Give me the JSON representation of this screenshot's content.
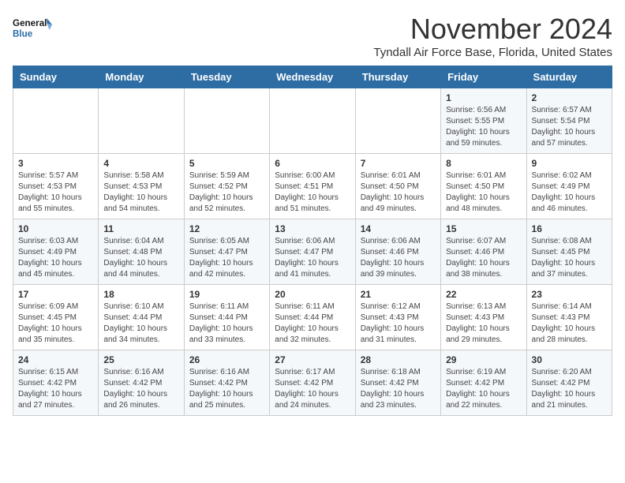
{
  "header": {
    "logo_line1": "General",
    "logo_line2": "Blue",
    "month": "November 2024",
    "location": "Tyndall Air Force Base, Florida, United States"
  },
  "weekdays": [
    "Sunday",
    "Monday",
    "Tuesday",
    "Wednesday",
    "Thursday",
    "Friday",
    "Saturday"
  ],
  "weeks": [
    [
      {
        "day": "",
        "info": ""
      },
      {
        "day": "",
        "info": ""
      },
      {
        "day": "",
        "info": ""
      },
      {
        "day": "",
        "info": ""
      },
      {
        "day": "",
        "info": ""
      },
      {
        "day": "1",
        "info": "Sunrise: 6:56 AM\nSunset: 5:55 PM\nDaylight: 10 hours and 59 minutes."
      },
      {
        "day": "2",
        "info": "Sunrise: 6:57 AM\nSunset: 5:54 PM\nDaylight: 10 hours and 57 minutes."
      }
    ],
    [
      {
        "day": "3",
        "info": "Sunrise: 5:57 AM\nSunset: 4:53 PM\nDaylight: 10 hours and 55 minutes."
      },
      {
        "day": "4",
        "info": "Sunrise: 5:58 AM\nSunset: 4:53 PM\nDaylight: 10 hours and 54 minutes."
      },
      {
        "day": "5",
        "info": "Sunrise: 5:59 AM\nSunset: 4:52 PM\nDaylight: 10 hours and 52 minutes."
      },
      {
        "day": "6",
        "info": "Sunrise: 6:00 AM\nSunset: 4:51 PM\nDaylight: 10 hours and 51 minutes."
      },
      {
        "day": "7",
        "info": "Sunrise: 6:01 AM\nSunset: 4:50 PM\nDaylight: 10 hours and 49 minutes."
      },
      {
        "day": "8",
        "info": "Sunrise: 6:01 AM\nSunset: 4:50 PM\nDaylight: 10 hours and 48 minutes."
      },
      {
        "day": "9",
        "info": "Sunrise: 6:02 AM\nSunset: 4:49 PM\nDaylight: 10 hours and 46 minutes."
      }
    ],
    [
      {
        "day": "10",
        "info": "Sunrise: 6:03 AM\nSunset: 4:49 PM\nDaylight: 10 hours and 45 minutes."
      },
      {
        "day": "11",
        "info": "Sunrise: 6:04 AM\nSunset: 4:48 PM\nDaylight: 10 hours and 44 minutes."
      },
      {
        "day": "12",
        "info": "Sunrise: 6:05 AM\nSunset: 4:47 PM\nDaylight: 10 hours and 42 minutes."
      },
      {
        "day": "13",
        "info": "Sunrise: 6:06 AM\nSunset: 4:47 PM\nDaylight: 10 hours and 41 minutes."
      },
      {
        "day": "14",
        "info": "Sunrise: 6:06 AM\nSunset: 4:46 PM\nDaylight: 10 hours and 39 minutes."
      },
      {
        "day": "15",
        "info": "Sunrise: 6:07 AM\nSunset: 4:46 PM\nDaylight: 10 hours and 38 minutes."
      },
      {
        "day": "16",
        "info": "Sunrise: 6:08 AM\nSunset: 4:45 PM\nDaylight: 10 hours and 37 minutes."
      }
    ],
    [
      {
        "day": "17",
        "info": "Sunrise: 6:09 AM\nSunset: 4:45 PM\nDaylight: 10 hours and 35 minutes."
      },
      {
        "day": "18",
        "info": "Sunrise: 6:10 AM\nSunset: 4:44 PM\nDaylight: 10 hours and 34 minutes."
      },
      {
        "day": "19",
        "info": "Sunrise: 6:11 AM\nSunset: 4:44 PM\nDaylight: 10 hours and 33 minutes."
      },
      {
        "day": "20",
        "info": "Sunrise: 6:11 AM\nSunset: 4:44 PM\nDaylight: 10 hours and 32 minutes."
      },
      {
        "day": "21",
        "info": "Sunrise: 6:12 AM\nSunset: 4:43 PM\nDaylight: 10 hours and 31 minutes."
      },
      {
        "day": "22",
        "info": "Sunrise: 6:13 AM\nSunset: 4:43 PM\nDaylight: 10 hours and 29 minutes."
      },
      {
        "day": "23",
        "info": "Sunrise: 6:14 AM\nSunset: 4:43 PM\nDaylight: 10 hours and 28 minutes."
      }
    ],
    [
      {
        "day": "24",
        "info": "Sunrise: 6:15 AM\nSunset: 4:42 PM\nDaylight: 10 hours and 27 minutes."
      },
      {
        "day": "25",
        "info": "Sunrise: 6:16 AM\nSunset: 4:42 PM\nDaylight: 10 hours and 26 minutes."
      },
      {
        "day": "26",
        "info": "Sunrise: 6:16 AM\nSunset: 4:42 PM\nDaylight: 10 hours and 25 minutes."
      },
      {
        "day": "27",
        "info": "Sunrise: 6:17 AM\nSunset: 4:42 PM\nDaylight: 10 hours and 24 minutes."
      },
      {
        "day": "28",
        "info": "Sunrise: 6:18 AM\nSunset: 4:42 PM\nDaylight: 10 hours and 23 minutes."
      },
      {
        "day": "29",
        "info": "Sunrise: 6:19 AM\nSunset: 4:42 PM\nDaylight: 10 hours and 22 minutes."
      },
      {
        "day": "30",
        "info": "Sunrise: 6:20 AM\nSunset: 4:42 PM\nDaylight: 10 hours and 21 minutes."
      }
    ]
  ]
}
